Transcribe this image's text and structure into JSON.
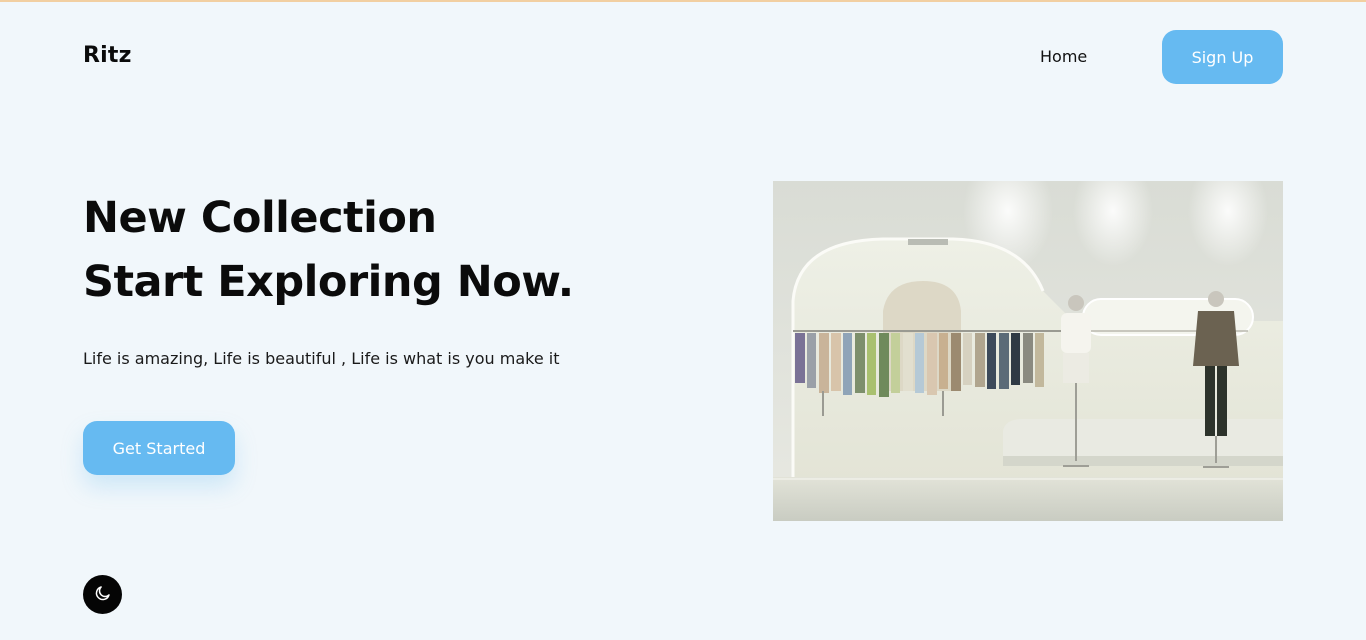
{
  "header": {
    "brand": "Ritz",
    "nav": {
      "home_label": "Home",
      "signup_label": "Sign Up"
    }
  },
  "hero": {
    "title_line1": "New Collection",
    "title_line2": "Start Exploring Now.",
    "subtitle": "Life is amazing, Life is beautiful , Life is what is you make it",
    "cta_label": "Get Started",
    "image_icon": "boutique-store-interior-photo"
  },
  "theme_toggle": {
    "icon": "moon-icon"
  },
  "colors": {
    "background": "#f1f7fb",
    "accent": "#66baf1",
    "text": "#0b0b0b",
    "toggle_bg": "#050505"
  }
}
